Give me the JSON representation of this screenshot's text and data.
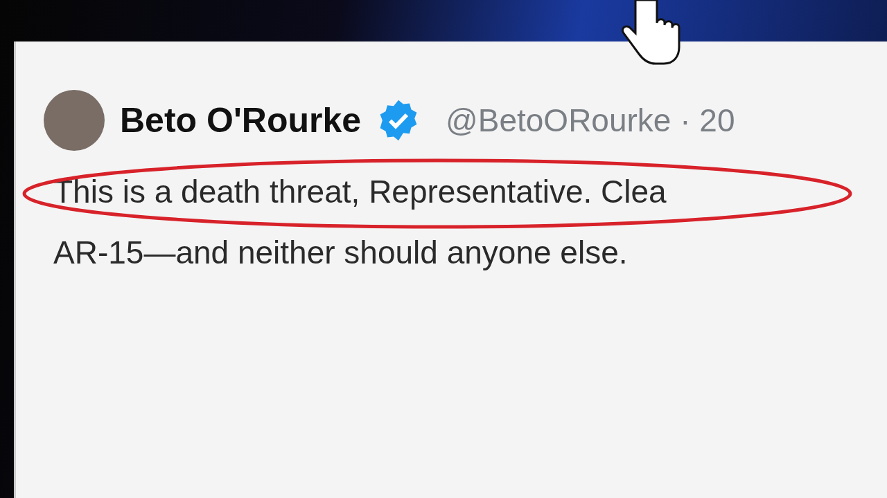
{
  "tweet": {
    "author_name": "Beto O'Rourke",
    "verified": true,
    "handle_time": "@BetoORourke · 20",
    "text_lines": [
      "This is a death threat, Representative. Clea",
      "AR-15—and neither should anyone else."
    ]
  }
}
